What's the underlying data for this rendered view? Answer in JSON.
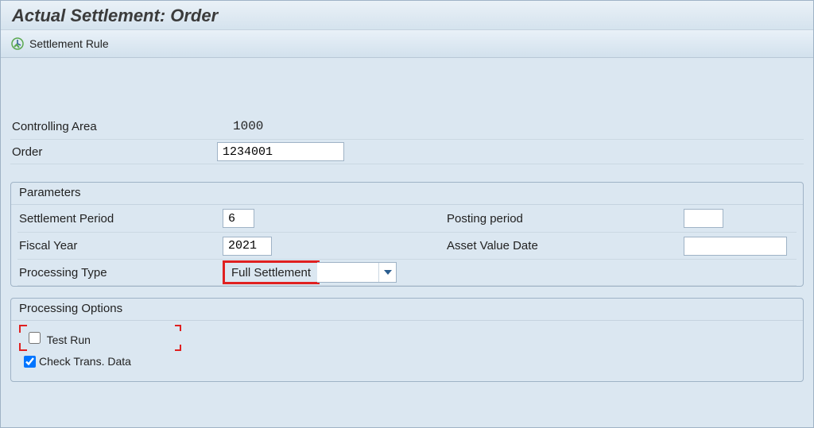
{
  "title": "Actual Settlement: Order",
  "toolbar": {
    "settlement_rule": "Settlement Rule"
  },
  "header": {
    "controlling_area_label": "Controlling Area",
    "controlling_area_value": "1000",
    "order_label": "Order",
    "order_value": "1234001"
  },
  "parameters": {
    "legend": "Parameters",
    "settlement_period_label": "Settlement Period",
    "settlement_period_value": "6",
    "fiscal_year_label": "Fiscal Year",
    "fiscal_year_value": "2021",
    "processing_type_label": "Processing Type",
    "processing_type_value": "Full Settlement",
    "posting_period_label": "Posting period",
    "posting_period_value": "",
    "asset_value_date_label": "Asset Value Date",
    "asset_value_date_value": ""
  },
  "processing_options": {
    "legend": "Processing Options",
    "test_run_label": "Test Run",
    "test_run_checked": false,
    "check_trans_label": "Check Trans. Data",
    "check_trans_checked": true
  }
}
